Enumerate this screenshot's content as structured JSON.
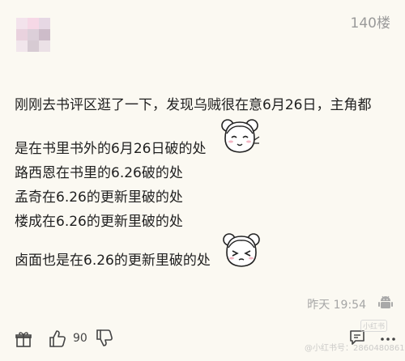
{
  "post": {
    "floor": "140楼",
    "lines": [
      "刚刚去书评区逛了一下，发现乌贼很在意6月26日，主角都",
      "是在书里书外的6月26日破的处",
      "路西恩在书里的6.26破的处",
      "孟奇在6.26的更新里破的处",
      "楼成在6.26的更新里破的处",
      "卤面也是在6.26的更新里破的处"
    ],
    "time": "昨天 19:54"
  },
  "actions": {
    "like_count": "90"
  },
  "watermark": {
    "text": "@小红书号：2860480861",
    "logo": "小红书"
  },
  "icons": {
    "gift": "gift-icon",
    "like": "thumbs-up-icon",
    "dislike": "thumbs-down-icon",
    "comment": "comment-icon",
    "more": "more-icon",
    "android": "android-icon",
    "sticker": "anime-girl-sticker"
  }
}
